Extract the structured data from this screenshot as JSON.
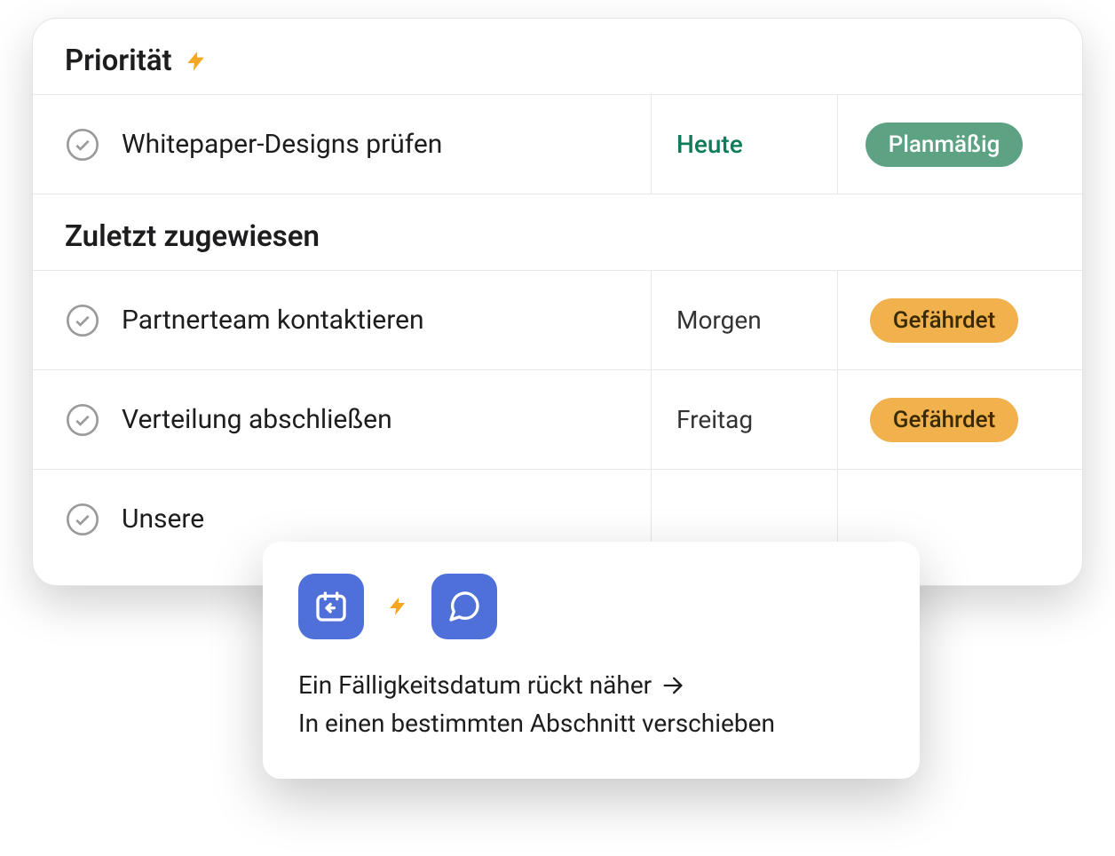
{
  "colors": {
    "accent_blue": "#4f6fd9",
    "badge_green": "#5da283",
    "badge_orange": "#f1b14c",
    "bolt": "#f5a623",
    "today_green": "#0f7b5a"
  },
  "sections": {
    "priority": {
      "title": "Priorität",
      "icon": "bolt-icon",
      "tasks": [
        {
          "title": "Whitepaper-Designs prüfen",
          "date": "Heute",
          "date_kind": "today",
          "status": "Planmäßig",
          "status_kind": "green"
        }
      ]
    },
    "recently_assigned": {
      "title": "Zuletzt zugewiesen",
      "tasks": [
        {
          "title": "Partnerteam kontaktieren",
          "date": "Morgen",
          "date_kind": "normal",
          "status": "Gefährdet",
          "status_kind": "orange"
        },
        {
          "title": "Verteilung abschließen",
          "date": "Freitag",
          "date_kind": "normal",
          "status": "Gefährdet",
          "status_kind": "orange"
        },
        {
          "title": "Unsere",
          "date": "",
          "date_kind": "normal",
          "status": "",
          "status_kind": ""
        }
      ]
    }
  },
  "popover": {
    "icons": [
      "calendar-back-icon",
      "bolt-icon",
      "chat-bubble-icon"
    ],
    "line1": "Ein Fälligkeitsdatum rückt näher",
    "line1_suffix_icon": "arrow-right-icon",
    "line2": "In einen bestimmten Abschnitt verschieben"
  }
}
